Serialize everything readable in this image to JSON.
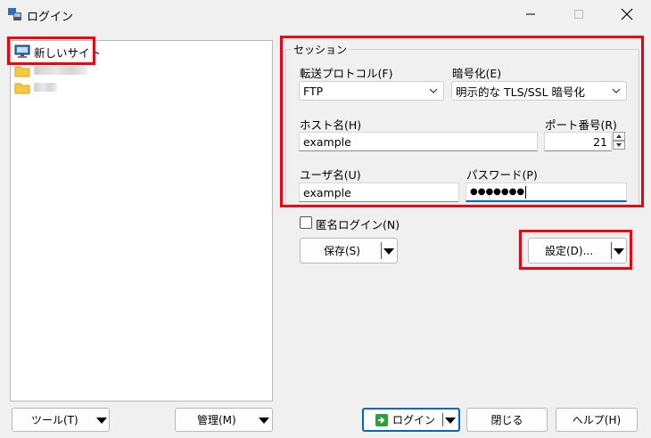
{
  "window": {
    "title": "ログイン"
  },
  "tree": {
    "items": [
      {
        "label": "新しいサイト"
      }
    ]
  },
  "session": {
    "group_title": "セッション",
    "protocol_label": "転送プロトコル(F)",
    "protocol_value": "FTP",
    "encryption_label": "暗号化(E)",
    "encryption_value": "明示的な TLS/SSL 暗号化",
    "host_label": "ホスト名(H)",
    "host_value": "example",
    "port_label": "ポート番号(R)",
    "port_value": "21",
    "user_label": "ユーザ名(U)",
    "user_value": "example",
    "password_label": "パスワード(P)",
    "password_value": "●●●●●●●"
  },
  "anonymous_login": {
    "label": "匿名ログイン(N)",
    "checked": false
  },
  "buttons": {
    "save": "保存(S)",
    "settings": "設定(D)...",
    "tools": "ツール(T)",
    "manage": "管理(M)",
    "login": "ログイン",
    "close": "閉じる",
    "help": "ヘルプ(H)"
  },
  "colors": {
    "highlight": "#e60012",
    "accent": "#0067c0"
  }
}
